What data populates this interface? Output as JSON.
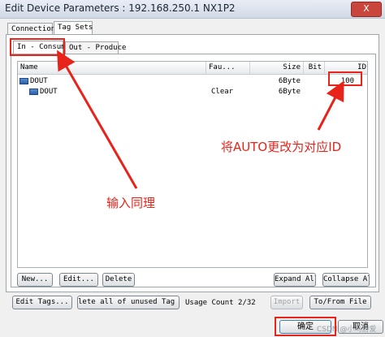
{
  "window": {
    "title": "Edit Device Parameters : 192.168.250.1 NX1P2",
    "close_label": "X"
  },
  "outer_tabs": [
    "Connections",
    "Tag Sets"
  ],
  "inner_tabs": [
    "In - Consume",
    "Out - Produce"
  ],
  "grid": {
    "columns": [
      "Name",
      "Fau...",
      "Size",
      "Bit",
      "ID"
    ],
    "rows": [
      {
        "name": "DOUT",
        "fault": "",
        "size": "6Byte",
        "bit": "",
        "id": "100"
      },
      {
        "name": "DOUT",
        "fault": "Clear",
        "size": "6Byte",
        "bit": "",
        "id": ""
      }
    ]
  },
  "buttons": {
    "new": "New...",
    "edit": "Edit...",
    "delete": "Delete",
    "expand_all": "Expand All",
    "collapse_all": "Collapse All",
    "edit_tags": "Edit Tags...",
    "delete_unused": "lete all of unused Tag Set",
    "usage_count": "Usage Count 2/32",
    "import": "Import",
    "to_from_file": "To/From File",
    "ok": "确定",
    "cancel": "取消"
  },
  "annotations": {
    "auto_note": "将AUTO更改为对应ID",
    "same_note": "输入同理",
    "accent": "#e8231a"
  },
  "watermark": "CSDN @小鸟游爱"
}
